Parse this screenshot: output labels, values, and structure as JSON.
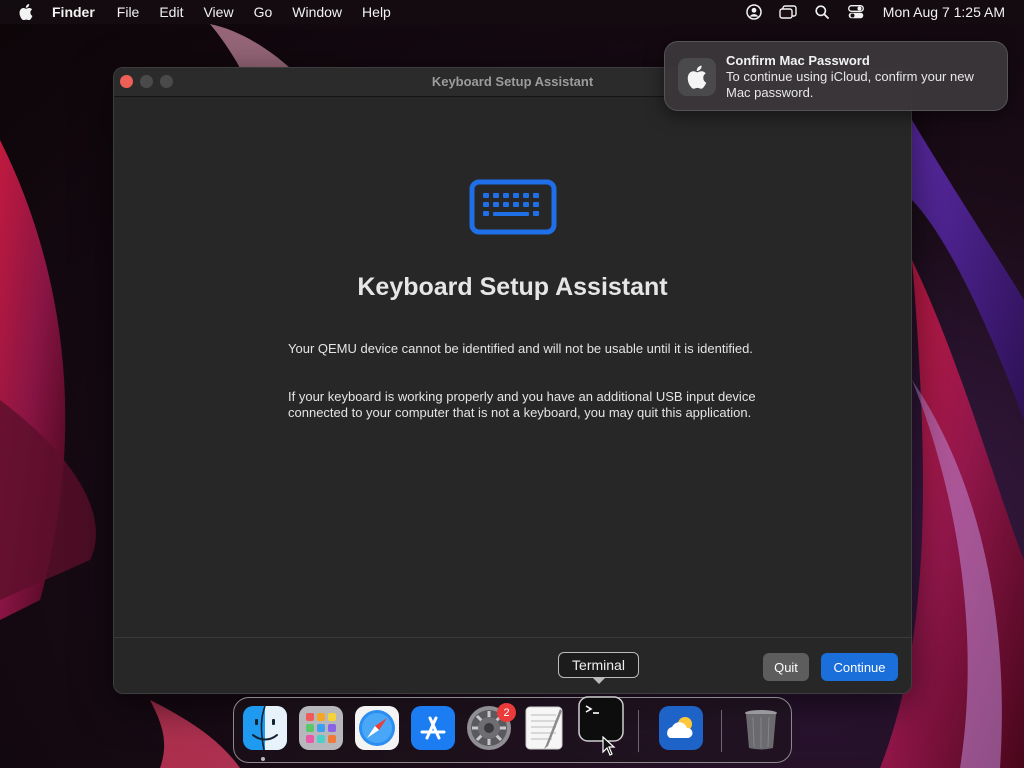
{
  "menubar": {
    "app_name": "Finder",
    "items": [
      "File",
      "Edit",
      "View",
      "Go",
      "Window",
      "Help"
    ],
    "clock": "Mon Aug 7  1:25 AM",
    "status_icons": [
      "user-icon",
      "screen-mirroring-icon",
      "spotlight-icon",
      "control-center-icon"
    ]
  },
  "window": {
    "title": "Keyboard Setup Assistant",
    "heading": "Keyboard Setup Assistant",
    "paragraph1": "Your QEMU device cannot be identified and will not be usable until it is identified.",
    "paragraph2": "If your keyboard is working properly and you have an additional USB input device connected to your computer that is not a keyboard, you may quit this application.",
    "quit_label": "Quit",
    "continue_label": "Continue"
  },
  "notification": {
    "title": "Confirm Mac Password",
    "body": "To continue using iCloud, confirm your new Mac password."
  },
  "dock": {
    "items": [
      "Finder",
      "Launchpad",
      "Safari",
      "App Store",
      "System Settings",
      "TextEdit",
      "Terminal",
      "Weather",
      "Trash"
    ],
    "settings_badge": "2",
    "tooltip": "Terminal"
  },
  "colors": {
    "accent": "#1a6fdb",
    "close": "#ed5f57",
    "keyboard_icon": "#1f6fe8",
    "badge": "#ea3b3a"
  }
}
